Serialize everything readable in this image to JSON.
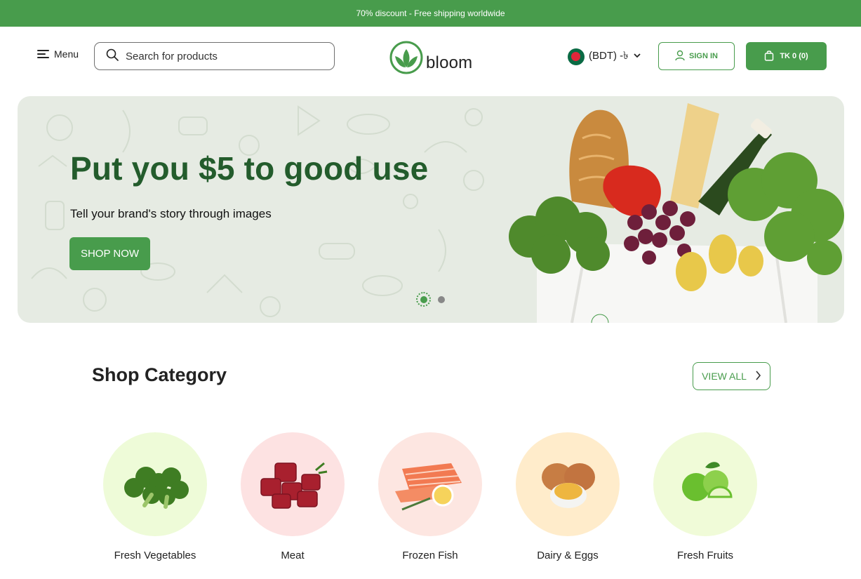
{
  "topbar": {
    "promo": "70% discount - Free shipping worldwide"
  },
  "header": {
    "menu_label": "Menu",
    "search_placeholder": "Search for products",
    "logo_text": "bloom",
    "currency": "(BDT) -৳",
    "signin_label": "SIGN IN",
    "cart_label": "TK 0  (0)"
  },
  "hero": {
    "title": "Put you $5 to good use",
    "subtitle": "Tell your brand's story through images",
    "cta": "SHOP NOW",
    "slides": 2,
    "active_slide": 1
  },
  "categories_section": {
    "title": "Shop Category",
    "view_all": "VIEW ALL",
    "items": [
      {
        "label": "Fresh Vegetables",
        "bg": "#eefbd8",
        "icon": "broccoli-icon"
      },
      {
        "label": "Meat",
        "bg": "#fde2e2",
        "icon": "meat-icon"
      },
      {
        "label": "Frozen Fish",
        "bg": "#fde6e1",
        "icon": "fish-icon"
      },
      {
        "label": "Dairy & Eggs",
        "bg": "#ffeccb",
        "icon": "eggs-icon"
      },
      {
        "label": "Fresh Fruits",
        "bg": "#f0fbd8",
        "icon": "apple-icon"
      }
    ]
  },
  "colors": {
    "brand": "#489c4c",
    "hero_title": "#235c2c",
    "hero_bg": "#e6ebe3"
  }
}
